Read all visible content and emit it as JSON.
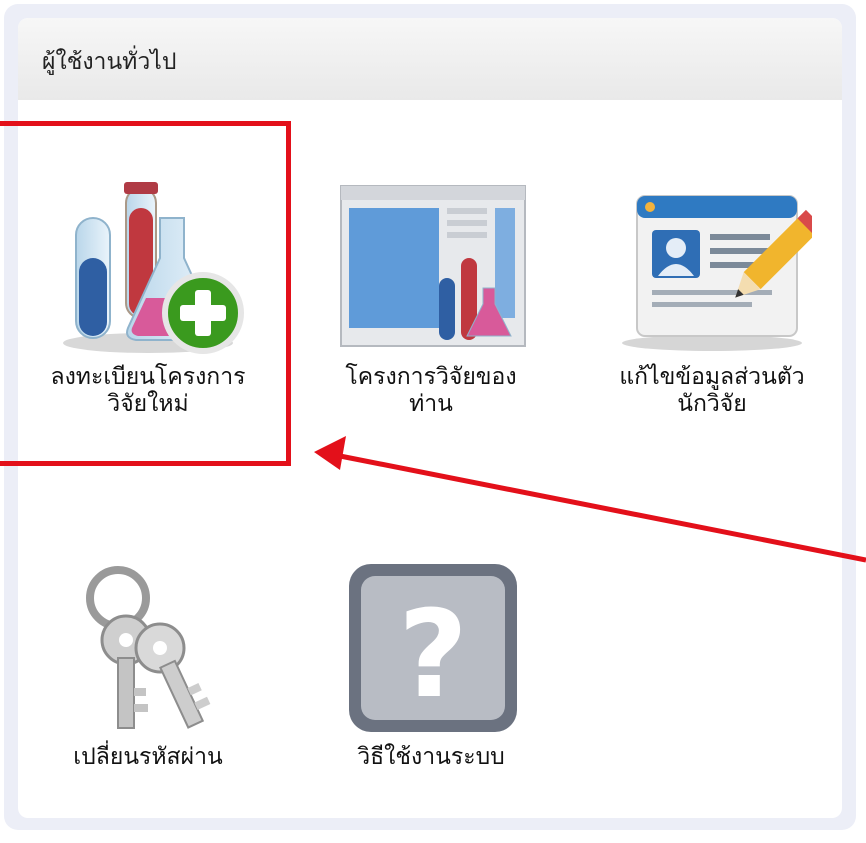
{
  "panel": {
    "title": "ผู้ใช้งานทั่วไป"
  },
  "tiles": [
    {
      "label_line1": "ลงทะเบียนโครงการ",
      "label_line2": "วิจัยใหม่",
      "icon": "test-tubes-add-icon"
    },
    {
      "label_line1": "โครงการวิจัยของ",
      "label_line2": "ท่าน",
      "icon": "research-window-icon"
    },
    {
      "label_line1": "แก้ไขข้อมูลส่วนตัว",
      "label_line2": "นักวิจัย",
      "icon": "profile-card-edit-icon"
    },
    {
      "label_line1": "เปลี่ยนรหัสผ่าน",
      "label_line2": "",
      "icon": "keys-icon"
    },
    {
      "label_line1": "วิธีใช้งานระบบ",
      "label_line2": "",
      "icon": "help-question-icon"
    }
  ],
  "colors": {
    "highlight": "#e3101a",
    "panel_bg": "#eceef7"
  }
}
